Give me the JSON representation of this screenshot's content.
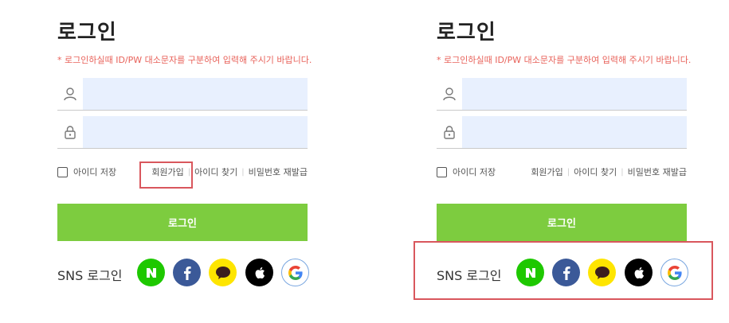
{
  "colors": {
    "accent_green": "#7dcc3f",
    "notice_red": "#e8625a",
    "input_bg": "#e8f0fe",
    "highlight": "#d9575d"
  },
  "left": {
    "title": "로그인",
    "notice": "* 로그인하실때 ID/PW 대소문자를 구분하여 입력해 주시기 바랍니다.",
    "id_value": "",
    "pw_value": "",
    "remember_label": "아이디 저장",
    "links": {
      "signup": "회원가입",
      "find_id": "아이디 찾기",
      "reset_pw": "비밀번호 재발급"
    },
    "login_button": "로그인",
    "sns_label": "SNS 로그인",
    "sns_icons": [
      "naver-icon",
      "facebook-icon",
      "kakao-icon",
      "apple-icon",
      "google-icon"
    ]
  },
  "right": {
    "title": "로그인",
    "notice": "* 로그인하실때 ID/PW 대소문자를 구분하여 입력해 주시기 바랍니다.",
    "id_value": "",
    "pw_value": "",
    "remember_label": "아이디 저장",
    "links": {
      "signup": "회원가입",
      "find_id": "아이디 찾기",
      "reset_pw": "비밀번호 재발급"
    },
    "login_button": "로그인",
    "sns_label": "SNS 로그인",
    "sns_icons": [
      "naver-icon",
      "facebook-icon",
      "kakao-icon",
      "apple-icon",
      "google-icon"
    ]
  }
}
